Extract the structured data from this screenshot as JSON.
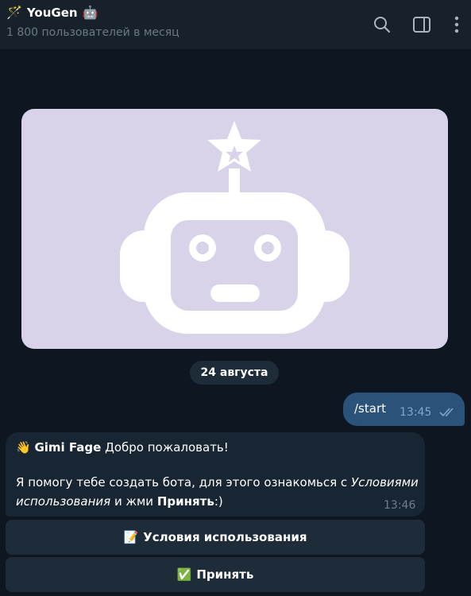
{
  "header": {
    "title_emoji": "🪄",
    "title": "YouGen",
    "title_emoji_after": "🤖",
    "subtitle": "1 800 пользователей в месяц",
    "icons": [
      "search-icon",
      "sidebar-toggle-icon",
      "more-vertical-icon"
    ]
  },
  "chat": {
    "date_separator": "24 августа",
    "outgoing": {
      "text": "/start",
      "time": "13:45",
      "status_icon": "double-check-icon"
    },
    "incoming": {
      "emoji": "👋",
      "sender": "Gimi Fage",
      "greeting": " Добро пожаловать!",
      "text_part1": "Я помогу тебе создать бота, для этого ознакомься с ",
      "link_italic_1": "Условиями",
      "link_italic_2": "использования",
      "text_part2": " и жми ",
      "bold_word": "Принять",
      "text_part3": ":)",
      "time": "13:46"
    },
    "buttons": [
      {
        "emoji": "📝",
        "label": "Условия использования"
      },
      {
        "emoji": "✅",
        "label": "Принять"
      }
    ]
  },
  "colors": {
    "background": "#0e1621",
    "header": "#17212b",
    "outgoing_bubble": "#2b5278",
    "incoming_bubble": "#182533",
    "image_bg": "#d8d3e8"
  }
}
